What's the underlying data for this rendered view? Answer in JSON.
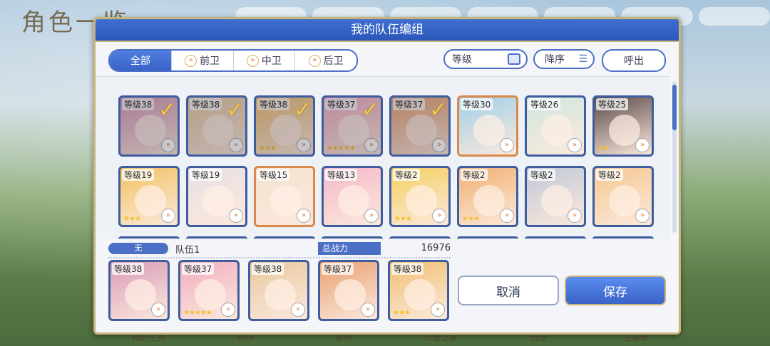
{
  "background": {
    "title": "角色一览",
    "bottom_nav": [
      "我的主页",
      "剧情",
      "冒险",
      "公会之家",
      "扭蛋",
      "主菜单"
    ]
  },
  "modal": {
    "title": "我的队伍编组",
    "filters": {
      "all": "全部",
      "front": "前卫",
      "middle": "中卫",
      "back": "后卫"
    },
    "sort_level": "等级",
    "sort_order": "降序",
    "call_out": "呼出",
    "roster": [
      {
        "level": "等级38",
        "stars": "",
        "selected": true
      },
      {
        "level": "等级38",
        "stars": "",
        "selected": true
      },
      {
        "level": "等级38",
        "stars": "★★★",
        "selected": true
      },
      {
        "level": "等级37",
        "stars": "★★★★★",
        "selected": true
      },
      {
        "level": "等级37",
        "stars": "",
        "selected": true
      },
      {
        "level": "等级30",
        "stars": "",
        "selected": false,
        "orange": true
      },
      {
        "level": "等级26",
        "stars": "",
        "selected": false
      },
      {
        "level": "等级25",
        "stars": "★★",
        "selected": false
      },
      {
        "level": "等级19",
        "stars": "★★★",
        "selected": false
      },
      {
        "level": "等级19",
        "stars": "",
        "selected": false
      },
      {
        "level": "等级15",
        "stars": "",
        "selected": false,
        "orange": true
      },
      {
        "level": "等级13",
        "stars": "",
        "selected": false
      },
      {
        "level": "等级2",
        "stars": "★★★",
        "selected": false
      },
      {
        "level": "等级2",
        "stars": "★★★",
        "selected": false
      },
      {
        "level": "等级2",
        "stars": "",
        "selected": false
      },
      {
        "level": "等级2",
        "stars": "",
        "selected": false
      }
    ],
    "team": {
      "tag": "无",
      "name": "队伍1",
      "power_label": "总战力",
      "power_value": "16976",
      "members": [
        {
          "level": "等级38",
          "stars": ""
        },
        {
          "level": "等级37",
          "stars": "★★★★★"
        },
        {
          "level": "等级38",
          "stars": ""
        },
        {
          "level": "等级37",
          "stars": ""
        },
        {
          "level": "等级38",
          "stars": "★★★"
        }
      ]
    },
    "cancel_label": "取消",
    "save_label": "保存"
  },
  "colors": {
    "accent": "#3a63c6",
    "gold": "#c9b47a",
    "check": "#f2c94c"
  }
}
